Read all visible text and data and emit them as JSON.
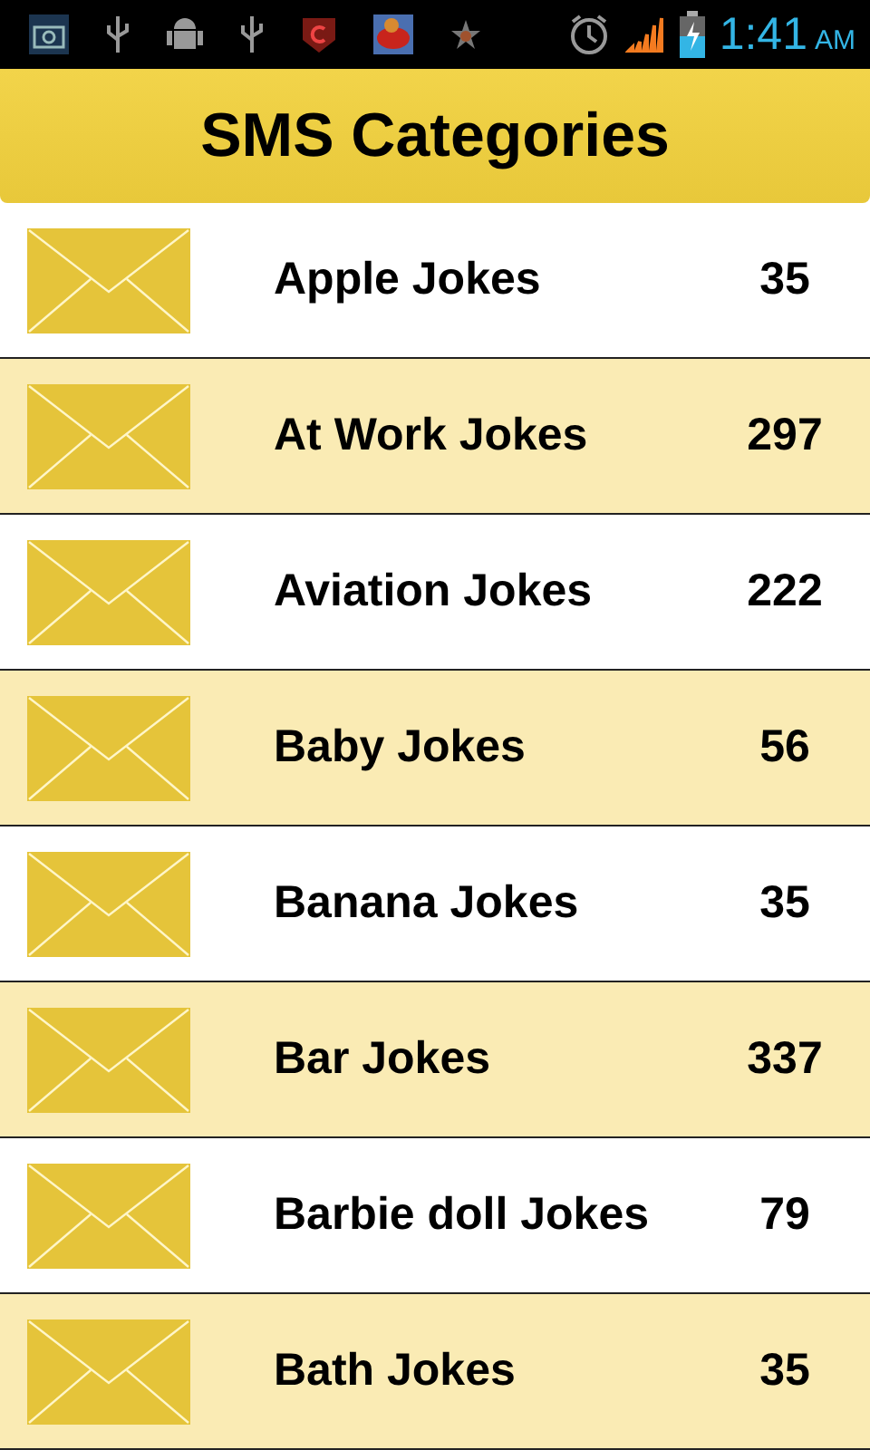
{
  "status_bar": {
    "time": "1:41",
    "meridiem": "AM"
  },
  "header": {
    "title": "SMS Categories"
  },
  "categories": [
    {
      "name": "Apple Jokes",
      "count": "35"
    },
    {
      "name": "At Work Jokes",
      "count": "297"
    },
    {
      "name": "Aviation Jokes",
      "count": "222"
    },
    {
      "name": "Baby Jokes",
      "count": "56"
    },
    {
      "name": "Banana Jokes",
      "count": "35"
    },
    {
      "name": "Bar Jokes",
      "count": "337"
    },
    {
      "name": "Barbie doll Jokes",
      "count": "79"
    },
    {
      "name": "Bath Jokes",
      "count": "35"
    }
  ]
}
